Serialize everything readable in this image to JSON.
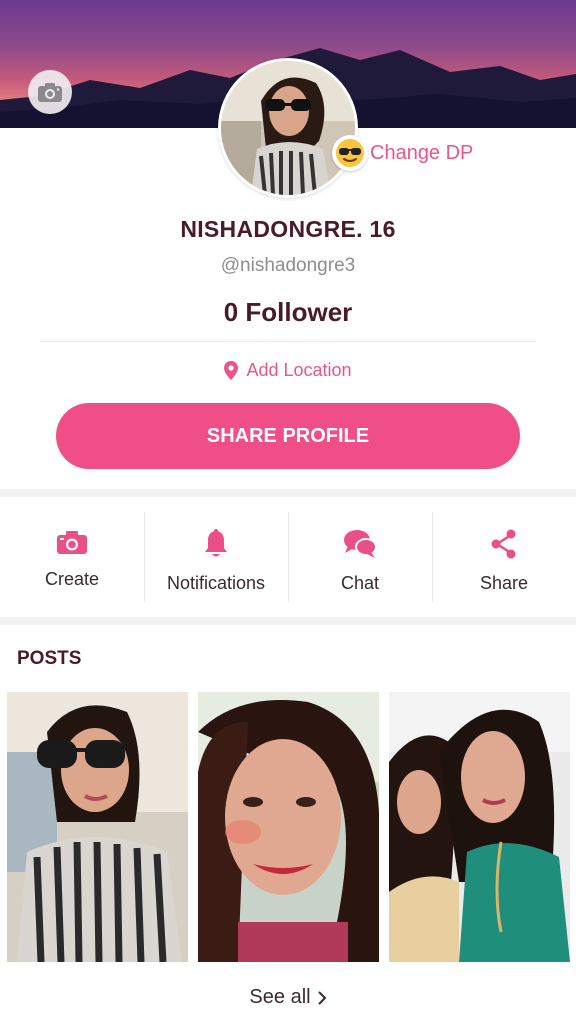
{
  "profile": {
    "change_dp_label": "Change DP",
    "name": "NISHADONGRE. 16",
    "handle": "@nishadongre3",
    "followers": "0 Follower",
    "add_location_label": "Add Location",
    "share_profile_label": "SHARE PROFILE"
  },
  "actions": [
    {
      "label": "Create",
      "icon": "camera-icon"
    },
    {
      "label": "Notifications",
      "icon": "bell-icon"
    },
    {
      "label": "Chat",
      "icon": "chat-bubbles-icon"
    },
    {
      "label": "Share",
      "icon": "share-icon"
    }
  ],
  "posts": {
    "title": "POSTS",
    "see_all_label": "See all"
  },
  "colors": {
    "accent": "#f04e86",
    "accent_text": "#e9558a",
    "dark_text": "#4a1a2a"
  }
}
